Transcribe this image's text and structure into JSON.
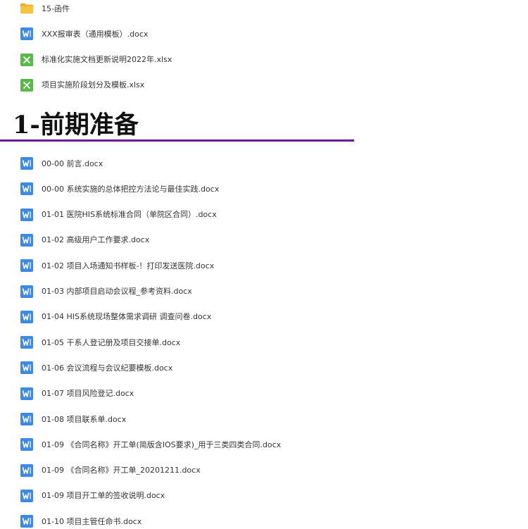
{
  "colors": {
    "folder": "#f5c242",
    "folder_dark": "#e8ae20",
    "word": "#3d8ae6",
    "excel": "#58b84a",
    "divider": "#6a1b9a"
  },
  "top_files": [
    {
      "name": "15-函件",
      "icon": "folder-icon"
    },
    {
      "name": "XXX报审表（通用模板）.docx",
      "icon": "word-doc-icon"
    },
    {
      "name": "标准化实施文档更新说明2022年.xlsx",
      "icon": "excel-sheet-icon"
    },
    {
      "name": "项目实施阶段划分及模板.xlsx",
      "icon": "excel-sheet-icon"
    }
  ],
  "section": {
    "title": "1-前期准备"
  },
  "section_files": [
    {
      "name": "00-00 前言.docx",
      "icon": "word-doc-icon"
    },
    {
      "name": "00-00 系统实施的总体把控方法论与最佳实践.docx",
      "icon": "word-doc-icon"
    },
    {
      "name": "01-01 医院HIS系统标准合同（单院区合同）.docx",
      "icon": "word-doc-icon"
    },
    {
      "name": "01-02 高级用户工作要求.docx",
      "icon": "word-doc-icon"
    },
    {
      "name": "01-02 项目入场通知书样板-！打印发送医院.docx",
      "icon": "word-doc-icon"
    },
    {
      "name": "01-03 内部项目启动会议程_参考资料.docx",
      "icon": "word-doc-icon"
    },
    {
      "name": "01-04 HIS系统现场整体需求调研 调查问卷.docx",
      "icon": "word-doc-icon"
    },
    {
      "name": "01-05 干系人登记册及项目交接单.docx",
      "icon": "word-doc-icon"
    },
    {
      "name": "01-06 会议流程与会议纪要模板.docx",
      "icon": "word-doc-icon"
    },
    {
      "name": "01-07 项目风险登记.docx",
      "icon": "word-doc-icon"
    },
    {
      "name": "01-08 项目联系单.docx",
      "icon": "word-doc-icon"
    },
    {
      "name": "01-09 《合同名称》开工单(简版含IOS要求)_用于三类四类合同.docx",
      "icon": "word-doc-icon"
    },
    {
      "name": "01-09 《合同名称》开工单_20201211.docx",
      "icon": "word-doc-icon"
    },
    {
      "name": "01-09 项目开工单的签收说明.docx",
      "icon": "word-doc-icon"
    },
    {
      "name": "01-10 项目主管任命书.docx",
      "icon": "word-doc-icon"
    }
  ]
}
